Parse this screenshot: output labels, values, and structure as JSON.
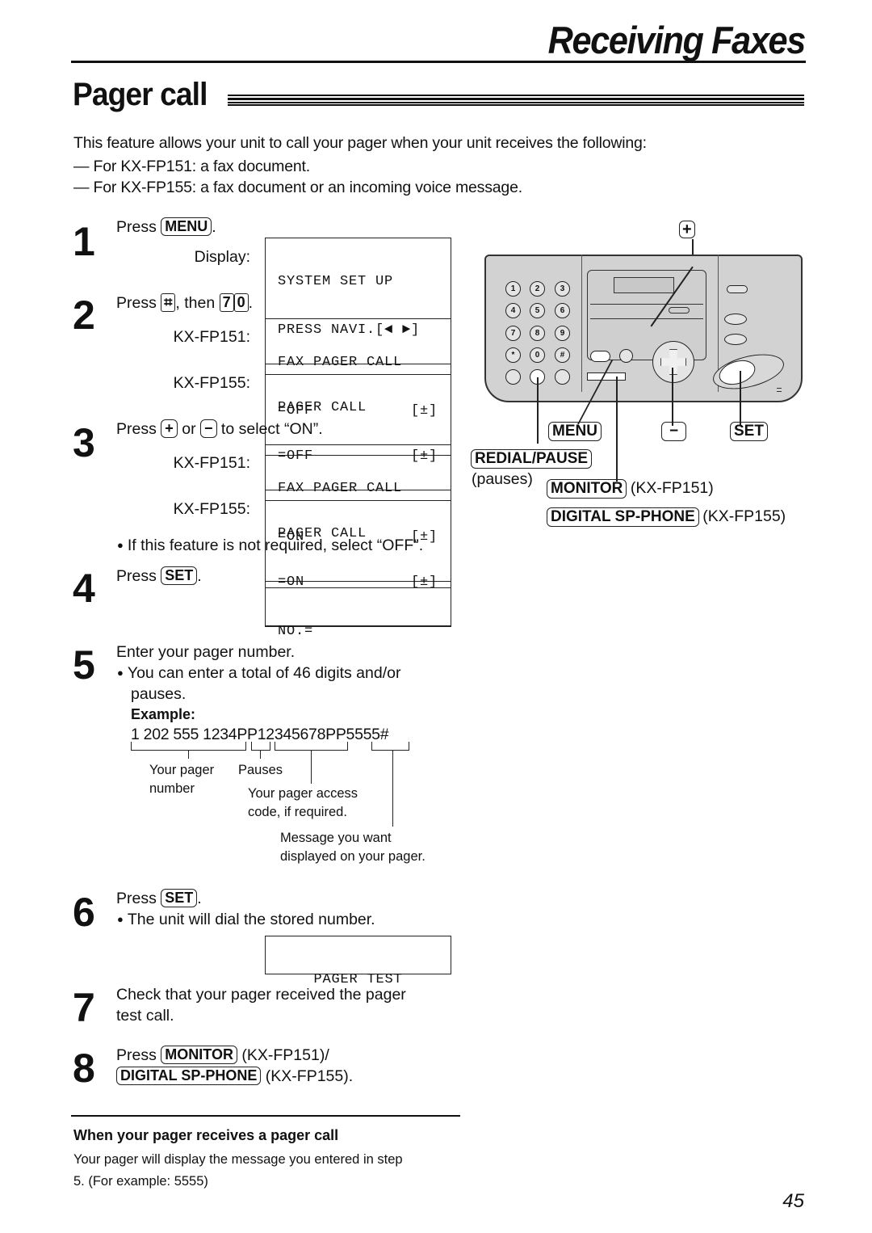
{
  "header": {
    "section_title": "Receiving Faxes",
    "page_title": "Pager call"
  },
  "intro": {
    "lead": "This feature allows your unit to call your pager when your unit receives the following:",
    "items": [
      "— For KX-FP151: a fax document.",
      "— For KX-FP155: a fax document or an incoming voice message."
    ]
  },
  "steps": {
    "s1": {
      "num": "1",
      "press": "Press",
      "key": "MENU",
      "after": ".",
      "display_label": "Display:",
      "lcd": [
        "SYSTEM SET UP",
        "PRESS NAVI.[◄ ►]"
      ]
    },
    "s2": {
      "num": "2",
      "press": "Press",
      "key1": "⌗",
      "mid": ", then",
      "key2": "7",
      "key3": "0",
      "after": ".",
      "model1": "KX-FP151:",
      "lcd1": [
        "FAX PAGER CALL",
        "=OFF",
        "[±]"
      ],
      "model2": "KX-FP155:",
      "lcd2": [
        "PAGER CALL",
        "=OFF",
        "[±]"
      ]
    },
    "s3": {
      "num": "3",
      "press": "Press",
      "key1": "+",
      "or": "or",
      "key2": "−",
      "after": "to select “ON”.",
      "model1": "KX-FP151:",
      "lcd1": [
        "FAX PAGER CALL",
        "=ON",
        "[±]"
      ],
      "model2": "KX-FP155:",
      "lcd2": [
        "PAGER CALL",
        "=ON",
        "[±]"
      ],
      "note": "If this feature is not required, select “OFF”."
    },
    "s4": {
      "num": "4",
      "press": "Press",
      "key": "SET",
      "after": ".",
      "lcd": "NO.="
    },
    "s5": {
      "num": "5",
      "text": "Enter your pager number.",
      "note_line1": "You can enter a total of 46 digits and/or",
      "note_line2": "pauses.",
      "example_label": "Example:",
      "example_value": "1 202 555 1234PP12345678PP5555#",
      "annotations": {
        "pager_number": [
          "Your pager",
          "number"
        ],
        "pauses": "Pauses",
        "access_code": [
          "Your pager access",
          "code, if required."
        ],
        "message": [
          "Message you want",
          "displayed on your pager."
        ]
      }
    },
    "s6": {
      "num": "6",
      "press": "Press",
      "key": "SET",
      "after": ".",
      "note": "The unit will dial the stored number.",
      "lcd": "PAGER TEST"
    },
    "s7": {
      "num": "7",
      "line1": "Check that your pager received the pager",
      "line2": "test call."
    },
    "s8": {
      "num": "8",
      "press": "Press",
      "key1": "MONITOR",
      "model1": "(KX-FP151)/",
      "key2": "DIGITAL SP-PHONE",
      "model2": "(KX-FP155)."
    }
  },
  "diagram": {
    "keypad": [
      "1",
      "2",
      "3",
      "4",
      "5",
      "6",
      "7",
      "8",
      "9",
      "*",
      "0",
      "#"
    ],
    "plus_key": "+",
    "minus_key": "−",
    "menu_key": "MENU",
    "set_key": "SET",
    "redial_key": "REDIAL/PAUSE",
    "redial_note": "(pauses)",
    "monitor_key": "MONITOR",
    "monitor_model": "(KX-FP151)",
    "spphone_key": "DIGITAL SP-PHONE",
    "spphone_model": "(KX-FP155)"
  },
  "footer": {
    "subtitle": "When your pager receives a pager call",
    "body_line1": "Your pager will display the message you entered in step",
    "body_line2": "5. (For example: 5555)",
    "page_number": "45"
  }
}
